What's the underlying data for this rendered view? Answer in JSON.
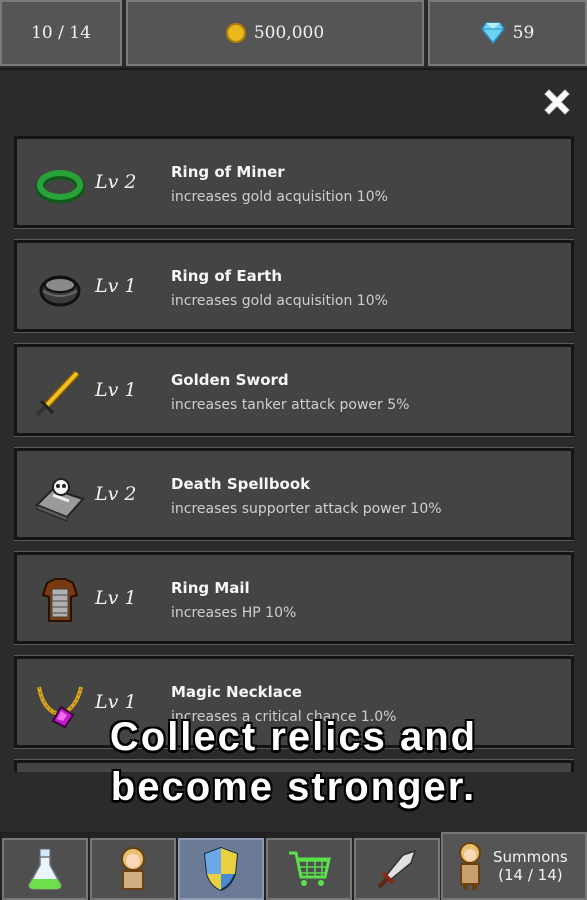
{
  "topbar": {
    "progress": "10 / 14",
    "gold": "500,000",
    "gems": "59"
  },
  "relics": [
    {
      "icon": "green-ring-icon",
      "level": "Lv 2",
      "name": "Ring of Miner",
      "desc": "increases gold acquisition 10%"
    },
    {
      "icon": "black-ring-icon",
      "level": "Lv 1",
      "name": "Ring of Earth",
      "desc": "increases gold acquisition 10%"
    },
    {
      "icon": "golden-sword-icon",
      "level": "Lv 1",
      "name": "Golden Sword",
      "desc": "increases tanker attack power 5%"
    },
    {
      "icon": "spellbook-icon",
      "level": "Lv 2",
      "name": "Death Spellbook",
      "desc": "increases supporter attack power 10%"
    },
    {
      "icon": "ring-mail-icon",
      "level": "Lv 1",
      "name": "Ring Mail",
      "desc": "increases HP 10%"
    },
    {
      "icon": "necklace-icon",
      "level": "Lv 1",
      "name": "Magic Necklace",
      "desc": "increases a critical chance 1.0%"
    }
  ],
  "caption": {
    "line1": "Collect relics and",
    "line2": "become stronger."
  },
  "bottombar": {
    "summons_label": "Summons",
    "summons_count": "(14 / 14)"
  }
}
